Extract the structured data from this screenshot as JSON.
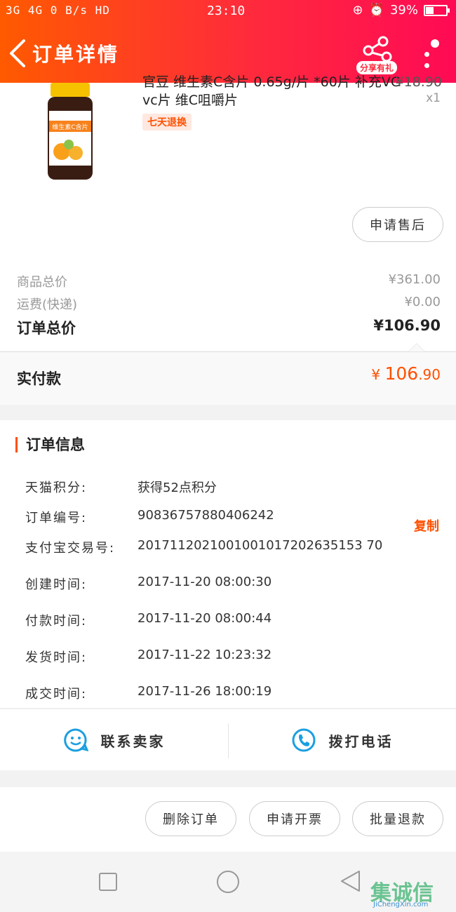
{
  "status_bar": {
    "left": "3G  4G  0 B/s  HD",
    "time": "23:10",
    "battery": "39%",
    "battery_level": 0.39
  },
  "nav": {
    "title": "订单详情",
    "share_label": "分享有礼"
  },
  "product": {
    "title": "官豆 维生素C含片 0.65g/片 *60片 补充VC vc片 维C咀嚼片",
    "price": "¥18.90",
    "quantity": "x1",
    "tag": "七天退换",
    "bottle_label": "维生素C含片",
    "after_sale_button": "申请售后"
  },
  "totals": {
    "goods_total_label": "商品总价",
    "goods_total_value": "¥361.00",
    "shipping_label": "运费(快递)",
    "shipping_value": "¥0.00",
    "order_total_label": "订单总价",
    "order_total_value": "¥106.90",
    "paid_label": "实付款",
    "paid_currency": "¥",
    "paid_int": "106",
    "paid_dec": ".90"
  },
  "order_info": {
    "title": "订单信息",
    "copy_label": "复制",
    "rows": [
      {
        "key": "天猫积分:",
        "value": "获得52点积分"
      },
      {
        "key": "订单编号:",
        "value": "90836757880406242"
      },
      {
        "key": "支付宝交易号:",
        "value": "2017112021001001017202635153 70"
      },
      {
        "key": "创建时间:",
        "value": "2017-11-20 08:00:30"
      },
      {
        "key": "付款时间:",
        "value": "2017-11-20 08:00:44"
      },
      {
        "key": "发货时间:",
        "value": "2017-11-22 10:23:32"
      },
      {
        "key": "成交时间:",
        "value": "2017-11-26 18:00:19"
      }
    ]
  },
  "contact": {
    "seller": "联系卖家",
    "phone": "拨打电话"
  },
  "actions": {
    "delete": "删除订单",
    "invoice": "申请开票",
    "refund": "批量退款"
  },
  "watermark": {
    "text": "集诚信",
    "site": "JiChengXin.com"
  },
  "colors": {
    "accent": "#ff5000",
    "header_start": "#ff5a00",
    "header_end": "#ff0a55",
    "icon_blue": "#1a9fe0"
  }
}
